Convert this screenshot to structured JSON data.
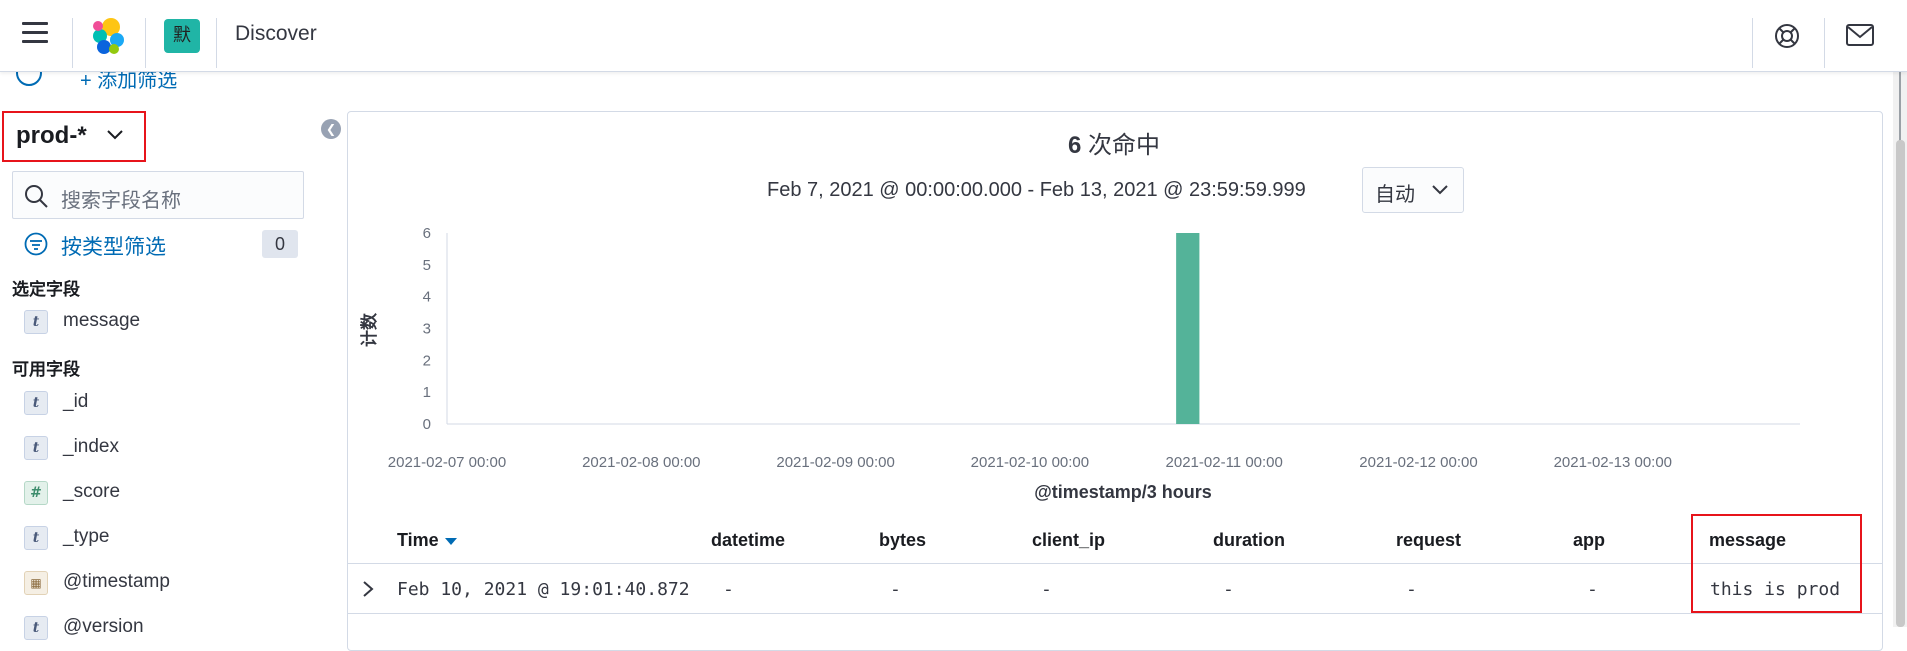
{
  "header": {
    "app_title": "Discover",
    "space_initial": "默",
    "icons": {
      "menu": "hamburger-icon",
      "logo": "elastic-logo",
      "help": "help-icon",
      "mail": "mail-icon"
    }
  },
  "filter_bar": {
    "add_filter_label": "+ 添加筛选"
  },
  "sidebar": {
    "index_pattern": "prod-*",
    "search_placeholder": "搜索字段名称",
    "type_filter_label": "按类型筛选",
    "type_filter_count": "0",
    "selected_title": "选定字段",
    "selected_fields": [
      {
        "type": "t",
        "name": "message"
      }
    ],
    "available_title": "可用字段",
    "available_fields": [
      {
        "type": "t",
        "name": "_id"
      },
      {
        "type": "t",
        "name": "_index"
      },
      {
        "type": "#",
        "name": "_score"
      },
      {
        "type": "t",
        "name": "_type"
      },
      {
        "type": "date",
        "name": "@timestamp"
      },
      {
        "type": "t",
        "name": "@version"
      }
    ]
  },
  "main": {
    "hits_count": "6",
    "hits_label": "次命中",
    "time_range": "Feb 7, 2021 @ 00:00:00.000 - Feb 13, 2021 @ 23:59:59.999",
    "interval": "自动"
  },
  "chart_data": {
    "type": "bar",
    "x_tick_labels": [
      "2021-02-07 00:00",
      "2021-02-08 00:00",
      "2021-02-09 00:00",
      "2021-02-10 00:00",
      "2021-02-11 00:00",
      "2021-02-12 00:00",
      "2021-02-13 00:00"
    ],
    "bars": [
      {
        "x": "2021-02-10 18:00",
        "value": 6
      }
    ],
    "xlabel": "@timestamp/3 hours",
    "ylabel": "计数",
    "ylim": [
      0,
      6
    ],
    "y_ticks": [
      0,
      1,
      2,
      3,
      4,
      5,
      6
    ],
    "bar_color": "#54b399",
    "grid": false
  },
  "table": {
    "columns": [
      "Time",
      "datetime",
      "bytes",
      "client_ip",
      "duration",
      "request",
      "app",
      "message"
    ],
    "rows": [
      [
        "Feb 10, 2021 @ 19:01:40.872",
        "-",
        "-",
        "-",
        "-",
        "-",
        "-",
        "this is prod"
      ]
    ]
  }
}
